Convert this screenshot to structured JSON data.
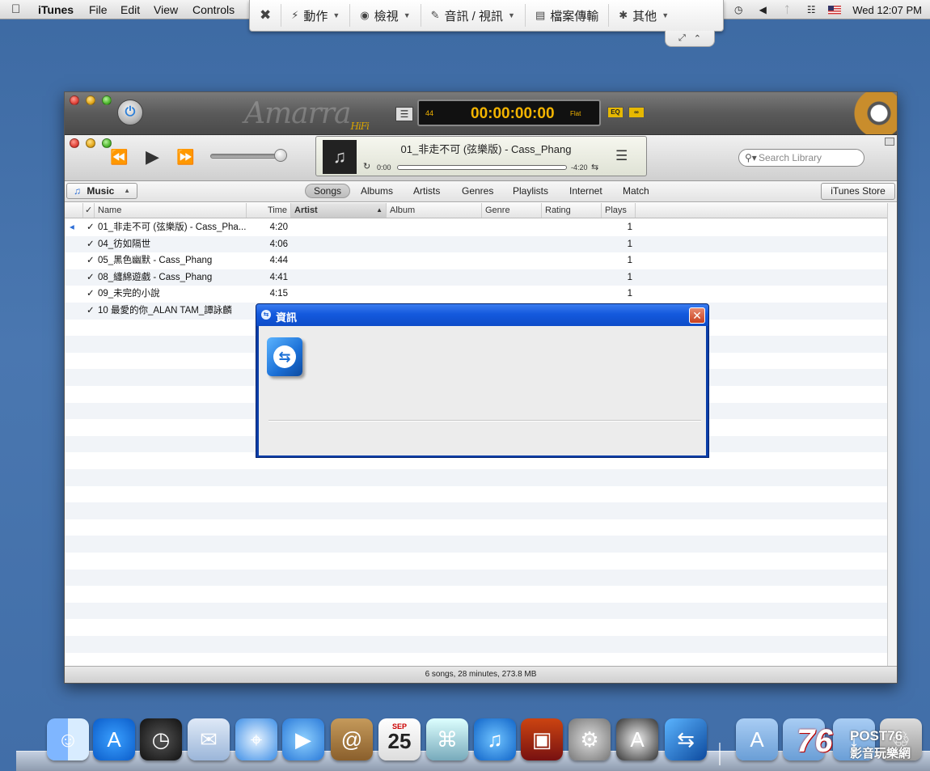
{
  "menubar": {
    "app_name": "iTunes",
    "items": [
      "File",
      "Edit",
      "View",
      "Controls"
    ],
    "clock": "Wed 12:07 PM"
  },
  "teamviewer_toolbar": {
    "items": [
      {
        "label": "",
        "icon": "close-session-icon"
      },
      {
        "label": "動作",
        "icon": "lightning-icon"
      },
      {
        "label": "檢視",
        "icon": "eye-icon"
      },
      {
        "label": "音訊 / 視訊",
        "icon": "speech-bubble-icon"
      },
      {
        "label": "檔案傳輸",
        "icon": "file-transfer-icon"
      },
      {
        "label": "其他",
        "icon": "puzzle-icon"
      }
    ]
  },
  "amarra": {
    "logo_text": "Amarra",
    "logo_sub": "HiFi",
    "sample_rate": "44",
    "time": "00:00:00:00",
    "mode": "Flat",
    "eq_label": "EQ"
  },
  "now_playing": {
    "title": "01_非走不可 (弦樂版) - Cass_Phang",
    "elapsed": "0:00",
    "remaining": "-4:20",
    "progress": 0
  },
  "search": {
    "placeholder": "Search Library"
  },
  "library": {
    "source": "Music",
    "tabs": [
      "Songs",
      "Albums",
      "Artists",
      "Genres",
      "Playlists",
      "Internet",
      "Match"
    ],
    "active_tab": "Songs",
    "store_button": "iTunes Store"
  },
  "columns": {
    "check": "✓",
    "name": "Name",
    "time": "Time",
    "artist": "Artist",
    "album": "Album",
    "genre": "Genre",
    "rating": "Rating",
    "plays": "Plays"
  },
  "tracks": [
    {
      "checked": "✓",
      "name": "01_非走不可 (弦樂版) - Cass_Pha...",
      "time": "4:20",
      "plays": "1",
      "playing": true
    },
    {
      "checked": "✓",
      "name": "04_彷如隔世",
      "time": "4:06",
      "plays": "1",
      "playing": false
    },
    {
      "checked": "✓",
      "name": "05_黑色幽默 - Cass_Phang",
      "time": "4:44",
      "plays": "1",
      "playing": false
    },
    {
      "checked": "✓",
      "name": "08_纏綿遊戲 - Cass_Phang",
      "time": "4:41",
      "plays": "1",
      "playing": false
    },
    {
      "checked": "✓",
      "name": "09_未完的小說",
      "time": "4:15",
      "plays": "1",
      "playing": false
    },
    {
      "checked": "✓",
      "name": "10 最愛的你_ALAN TAM_譚詠麟",
      "time": "",
      "plays": "",
      "playing": false
    }
  ],
  "status_text": "6 songs, 28 minutes, 273.8 MB",
  "dialog": {
    "title": "資訊",
    "close_label": "✕"
  },
  "dock": {
    "icons": [
      "finder-icon",
      "app-store-icon",
      "dashboard-icon",
      "mail-icon",
      "safari-icon",
      "facetime-icon",
      "address-book-icon",
      "calendar-icon",
      "iphoto-icon",
      "itunes-icon",
      "photo-booth-icon",
      "system-preferences-icon",
      "amarra-icon",
      "teamviewer-icon",
      "applications-folder-icon",
      "documents-folder-icon",
      "downloads-icon",
      "trash-icon"
    ],
    "calendar_month": "SEP",
    "calendar_day": "25"
  },
  "watermark": {
    "number": "76",
    "brand": "POST76",
    "subtitle": "影音玩樂網"
  },
  "colors": {
    "desktop": "#416ea8",
    "amarra_display_text": "#f3b400",
    "dialog_title_bar": "#1459dd",
    "selection_accent": "#2d6ed6"
  }
}
